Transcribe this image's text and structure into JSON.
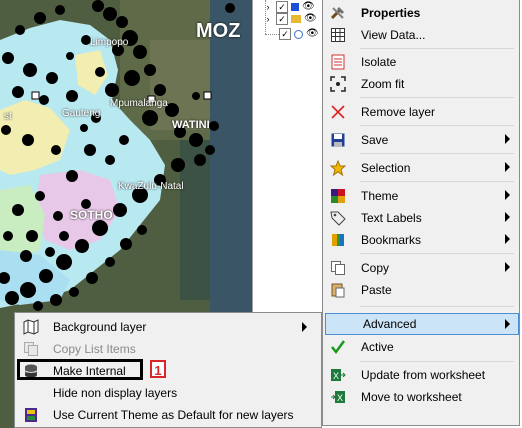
{
  "map": {
    "labels": [
      "MOZ",
      "Limpopo",
      "Mpumalanga",
      "Gauteng",
      "WATINI",
      "KwaZulu-Natal",
      "SOTHO",
      "st"
    ],
    "colors": {
      "satellite": "#4a5a3c",
      "zones_cyan": "#b8e8f0",
      "zones_yellow": "#f2edb0",
      "zones_pink": "#e8c8e8",
      "dots": "#000000"
    }
  },
  "layer_tree": {
    "rows": [
      {
        "checked": true,
        "icon": "blue-layer-icon"
      },
      {
        "checked": true,
        "icon": "folder-icon"
      },
      {
        "checked": true,
        "icon": "link-layer-icon"
      }
    ]
  },
  "context_menu": {
    "items": [
      {
        "label": "Properties",
        "icon": "wrench-hammer-icon",
        "bold": true,
        "submenu": false
      },
      {
        "label": "View Data...",
        "icon": "grid-table-icon",
        "submenu": false
      },
      {
        "label": "Isolate",
        "icon": "isolate-list-icon",
        "submenu": false
      },
      {
        "label": "Zoom fit",
        "icon": "zoom-fit-icon",
        "submenu": false
      },
      {
        "label": "Remove layer",
        "icon": "red-x-icon",
        "submenu": false
      },
      {
        "label": "Save",
        "icon": "floppy-disk-icon",
        "submenu": true
      },
      {
        "label": "Selection",
        "icon": "star-icon",
        "submenu": true
      },
      {
        "label": "Theme",
        "icon": "theme-palette-icon",
        "submenu": true
      },
      {
        "label": "Text Labels",
        "icon": "tag-icon",
        "submenu": true
      },
      {
        "label": "Bookmarks",
        "icon": "bookmarks-icon",
        "submenu": true
      },
      {
        "label": "Copy",
        "icon": "copy-icon",
        "submenu": true
      },
      {
        "label": "Paste",
        "icon": "paste-icon",
        "submenu": false
      },
      {
        "label": "Advanced",
        "icon": "",
        "submenu": true,
        "highlighted": true
      },
      {
        "label": "Active",
        "icon": "green-checkmark-icon",
        "submenu": false
      },
      {
        "label": "Update from worksheet",
        "icon": "excel-import-icon",
        "submenu": false
      },
      {
        "label": "Move to worksheet",
        "icon": "excel-export-icon",
        "submenu": false
      }
    ]
  },
  "advanced_submenu": {
    "items": [
      {
        "label": "Background layer",
        "icon": "map-book-icon",
        "submenu": true,
        "disabled": false
      },
      {
        "label": "Copy List Items",
        "icon": "copy-list-icon",
        "submenu": false,
        "disabled": true
      },
      {
        "label": "Make Internal",
        "icon": "database-layer-icon",
        "submenu": false,
        "disabled": false
      },
      {
        "label": "Hide non display layers",
        "icon": "",
        "submenu": false,
        "disabled": false
      },
      {
        "label": "Use Current Theme as Default for new layers",
        "icon": "theme-default-icon",
        "submenu": false,
        "disabled": false
      }
    ]
  },
  "annotation": {
    "callout_number": "1",
    "callout_color": "#d9262a"
  }
}
